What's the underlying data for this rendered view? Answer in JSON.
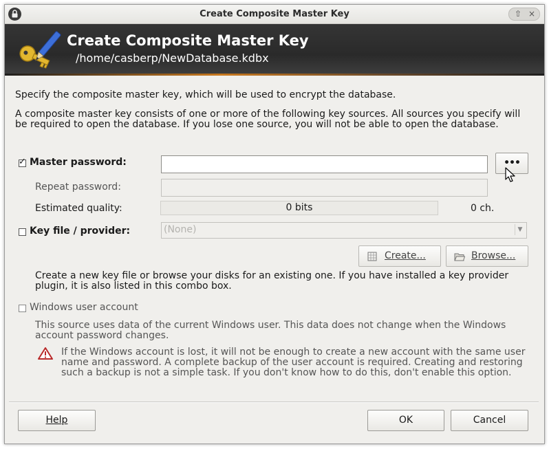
{
  "window": {
    "title": "Create Composite Master Key",
    "controls": [
      "⇧",
      "×"
    ]
  },
  "banner": {
    "title": "Create Composite Master Key",
    "path": "/home/casberp/NewDatabase.kdbx"
  },
  "intro": {
    "line1": "Specify the composite master key, which will be used to encrypt the database.",
    "line2a": "A composite master key consists of one or more of the following key sources. All sources you specify will",
    "line2b": "be required to open the database.  If you lose one source, you will not be able to open the database."
  },
  "password": {
    "checkbox_label": "Master password:",
    "checked": true,
    "value": "",
    "show_button": "•••",
    "repeat_label": "Repeat password:",
    "repeat_value": "",
    "quality_label": "Estimated quality:",
    "quality_value": "0 bits",
    "quality_fraction": 0,
    "chars": "0 ch."
  },
  "keyfile": {
    "checkbox_label": "Key file / provider:",
    "checked": false,
    "selected": "(None)",
    "create_button": "Create...",
    "browse_button": "Browse...",
    "help1": "Create a new key file or browse your disks for an existing one. If you have installed a key provider",
    "help2": "plugin, it is also listed in this combo box."
  },
  "winuser": {
    "checkbox_label": "Windows user account",
    "checked": false,
    "desc1": "This source uses data of the current Windows user. This data does not change when the Windows",
    "desc2": "account password changes.",
    "warn1": "If the Windows account is lost, it will not be enough to create a new account with the same user",
    "warn2": "name and password. A complete backup of the user account is required. Creating and restoring",
    "warn3": "such a backup is not a simple task. If you don't know how to do this, don't enable this option."
  },
  "footer": {
    "help": "Help",
    "ok": "OK",
    "cancel": "Cancel"
  }
}
